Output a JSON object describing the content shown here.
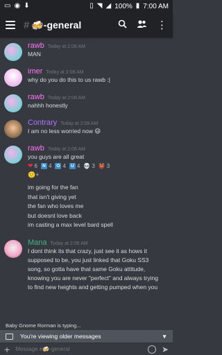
{
  "status": {
    "battery": "100%",
    "time": "7:00 AM"
  },
  "header": {
    "hash": "#",
    "channel": "🍻-general"
  },
  "colors": {
    "rawb": "#ff73fa",
    "imer": "#ff73fa",
    "contrary": "#b073ff",
    "mana": "#43b581"
  },
  "messages": [
    {
      "user": "rawb",
      "time": "Today at 2:08 AM",
      "lines": [
        "MAN"
      ]
    },
    {
      "user": "imer",
      "time": "Today at 2:08 AM",
      "lines": [
        "why do you do this to us rawb :|"
      ]
    },
    {
      "user": "rawb",
      "time": "Today at 2:08 AM",
      "lines": [
        "nahhh honestly"
      ]
    },
    {
      "user": "Contrary",
      "time": "Today at 2:08 AM",
      "lines": [
        "I am no less worried now 😄"
      ]
    },
    {
      "user": "rawb",
      "time": "Today at 2:08 AM",
      "lines": [
        "you guys are all great"
      ]
    },
    {
      "user": "Mana",
      "time": "Today at 2:08 AM",
      "lines": [
        "I dont think its that crazy, just see it as hows it",
        "supposed to be, you just linked that Goku SS3",
        "song, so gotta have that same Goku attitude,",
        "knowing you are never \"perfect\" and always trying",
        "to find new heights and getting pumped when you"
      ]
    }
  ],
  "reactions": [
    {
      "icon": "❤",
      "count": "6"
    },
    {
      "icon": "N",
      "count": "4"
    },
    {
      "icon": "O",
      "count": "4"
    },
    {
      "icon": "U",
      "count": "4"
    },
    {
      "icon": "💀",
      "count": "3"
    },
    {
      "icon": "👹",
      "count": "3"
    }
  ],
  "add_reaction": "🙂+",
  "rawb_followups": [
    "im going for the fan",
    "that isn't giving yet",
    "the fan who loves me",
    "but doesnt love back",
    "im casting a max level bard spell"
  ],
  "typing_text": "Baby Gnome Rorman is typing...",
  "older_banner": "You're viewing older messages",
  "input_placeholder": "Message #🍻-general"
}
